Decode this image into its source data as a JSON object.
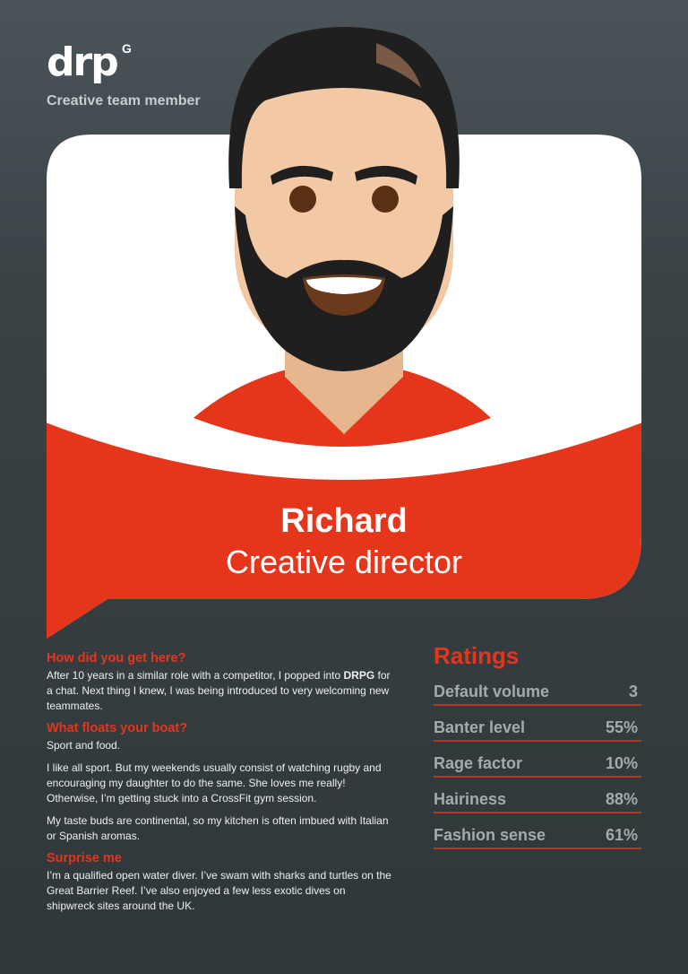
{
  "brand": {
    "logo_text": "drp",
    "logo_mark": "G",
    "tagline": "Creative team member"
  },
  "profile": {
    "name": "Richard",
    "role": "Creative director"
  },
  "colors": {
    "accent": "#e5351a",
    "card_white": "#ffffff",
    "background": "#343c40"
  },
  "bio": [
    {
      "heading": "How did you get here?",
      "paragraphs": [
        {
          "before": "After 10 years in a similar role with a competitor, I popped into ",
          "bold": "DRPG",
          "after": " for a chat. Next thing I knew, I was being introduced to very welcoming new teammates."
        }
      ]
    },
    {
      "heading": "What floats your boat?",
      "paragraphs": [
        {
          "text": "Sport and food."
        },
        {
          "text": "I like all sport. But my weekends usually consist of watching rugby and encouraging my daughter to do the same. She loves me really! Otherwise, I’m getting stuck into a CrossFit gym session."
        },
        {
          "text": "My taste buds are continental, so my kitchen is often imbued with Italian or Spanish aromas."
        }
      ]
    },
    {
      "heading": "Surprise me",
      "paragraphs": [
        {
          "text": "I’m a qualified open water diver. I’ve swam with sharks and turtles on the Great Barrier Reef. I’ve also enjoyed a few less exotic dives on shipwreck sites around the UK."
        }
      ]
    }
  ],
  "ratings": {
    "title": "Ratings",
    "items": [
      {
        "label": "Default volume",
        "value": "3"
      },
      {
        "label": "Banter level",
        "value": "55%"
      },
      {
        "label": "Rage factor",
        "value": "10%"
      },
      {
        "label": "Hairiness",
        "value": "88%"
      },
      {
        "label": "Fashion sense",
        "value": "61%"
      }
    ]
  }
}
